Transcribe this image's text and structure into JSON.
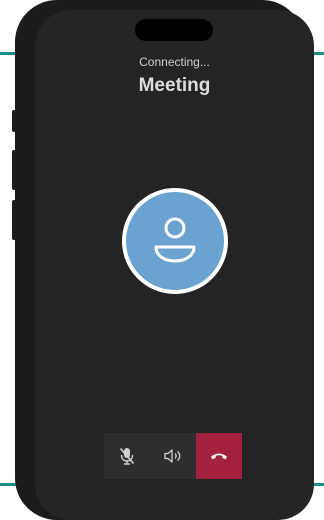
{
  "call": {
    "status": "Connecting...",
    "name": "Meeting"
  },
  "controls": [
    {
      "icon": "mic-off-icon"
    },
    {
      "icon": "speaker-icon"
    },
    {
      "icon": "end-call-icon"
    }
  ],
  "colors": {
    "accent": "#1f8f86",
    "avatar": "#6aa3d1",
    "end_call": "#a3203f",
    "screen": "#242424"
  }
}
